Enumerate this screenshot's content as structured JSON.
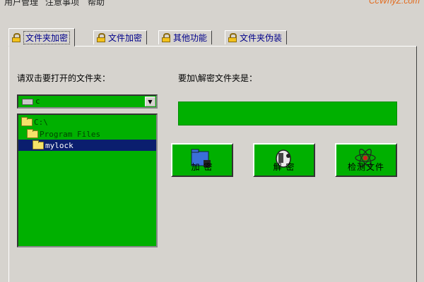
{
  "menu": {
    "items": [
      "用户管理",
      "注意事项",
      "帮助"
    ]
  },
  "brand": "CcWnyZ.com",
  "tabs": [
    {
      "label": "文件夹加密",
      "active": true
    },
    {
      "label": "文件加密",
      "active": false
    },
    {
      "label": "其他功能",
      "active": false
    },
    {
      "label": "文件夹伪装",
      "active": false
    }
  ],
  "left": {
    "prompt": "请双击要打开的文件夹：",
    "drive_value": "c",
    "tree": [
      "C:\\",
      "Program Files",
      "mylock"
    ],
    "selected": "mylock"
  },
  "right": {
    "prompt": "要加\\解密文件夹是：",
    "target_value": ""
  },
  "buttons": {
    "encrypt": "加 密",
    "decrypt": "解 密",
    "detect": "检测文件"
  },
  "colors": {
    "panel_green": "#00b000",
    "window_gray": "#d6d3ce",
    "selection": "#0a1e6e",
    "tab_text": "#00008b"
  }
}
